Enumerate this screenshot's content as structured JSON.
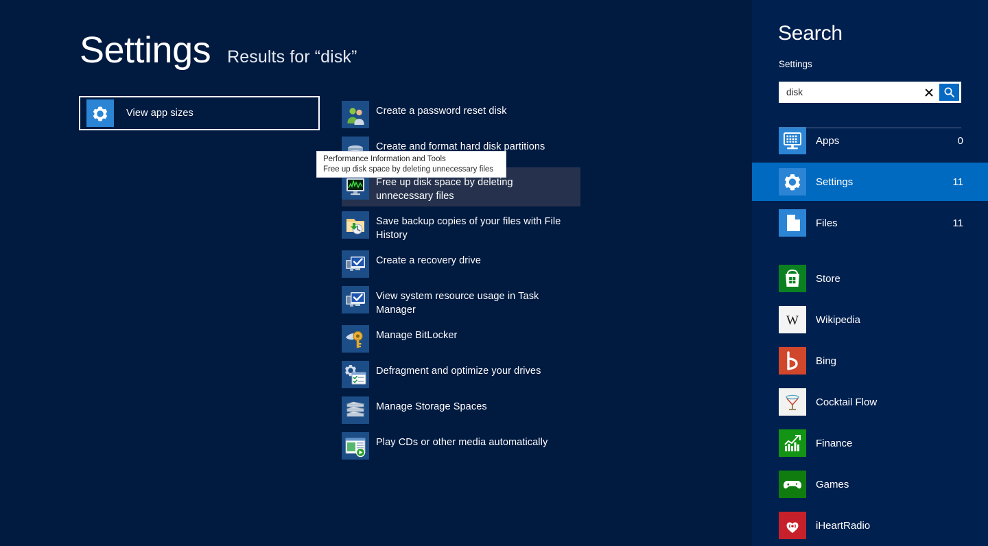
{
  "page": {
    "title": "Settings",
    "results_for": "Results for “disk”",
    "background_color": "#011a40",
    "panel_background_color": "#00204f",
    "accent_color": "#0069c0"
  },
  "focused_result": {
    "label": "View app sizes",
    "icon": "gear-settings-icon"
  },
  "results": [
    {
      "label": "Create a password reset disk",
      "icon": "users-accounts-icon",
      "hovered": false
    },
    {
      "label": "Create and format hard disk partitions",
      "icon": "disk-partitions-icon",
      "hovered": false
    },
    {
      "label": "Free up disk space by deleting unnecessary files",
      "icon": "performance-monitor-icon",
      "hovered": true
    },
    {
      "label": "Save backup copies of your files with File History",
      "icon": "file-history-folder-icon",
      "hovered": false
    },
    {
      "label": "Create a recovery drive",
      "icon": "recovery-drive-icon",
      "hovered": false
    },
    {
      "label": "View system resource usage in Task Manager",
      "icon": "task-manager-icon",
      "hovered": false
    },
    {
      "label": "Manage BitLocker",
      "icon": "bitlocker-key-icon",
      "hovered": false
    },
    {
      "label": "Defragment and optimize your drives",
      "icon": "defragment-icon",
      "hovered": false
    },
    {
      "label": "Manage Storage Spaces",
      "icon": "storage-spaces-icon",
      "hovered": false
    },
    {
      "label": "Play CDs or other media automatically",
      "icon": "autoplay-icon",
      "hovered": false
    }
  ],
  "tooltip": {
    "line1": "Performance Information and Tools",
    "line2": "Free up disk space by deleting unnecessary files"
  },
  "search": {
    "heading": "Search",
    "scope_label": "Settings",
    "query": "disk",
    "placeholder": "Search",
    "clear_icon": "close-icon",
    "submit_icon": "search-icon"
  },
  "categories": [
    {
      "label": "Apps",
      "count": "0",
      "icon": "apps-monitor-icon",
      "selected": false
    },
    {
      "label": "Settings",
      "count": "11",
      "icon": "gear-settings-icon",
      "selected": true
    },
    {
      "label": "Files",
      "count": "11",
      "icon": "document-page-icon",
      "selected": false
    }
  ],
  "apps": [
    {
      "label": "Store",
      "icon": "store-bag-icon",
      "tile_color": "#0b8021"
    },
    {
      "label": "Wikipedia",
      "icon": "wikipedia-w-icon",
      "tile_color": "#f4f4f4"
    },
    {
      "label": "Bing",
      "icon": "bing-b-icon",
      "tile_color": "#d1472c"
    },
    {
      "label": "Cocktail Flow",
      "icon": "cocktail-glass-icon",
      "tile_color": "#f2f2f0"
    },
    {
      "label": "Finance",
      "icon": "finance-chart-icon",
      "tile_color": "#149414"
    },
    {
      "label": "Games",
      "icon": "games-controller-icon",
      "tile_color": "#107c10"
    },
    {
      "label": "iHeartRadio",
      "icon": "iheartradio-icon",
      "tile_color": "#c6202a"
    }
  ]
}
